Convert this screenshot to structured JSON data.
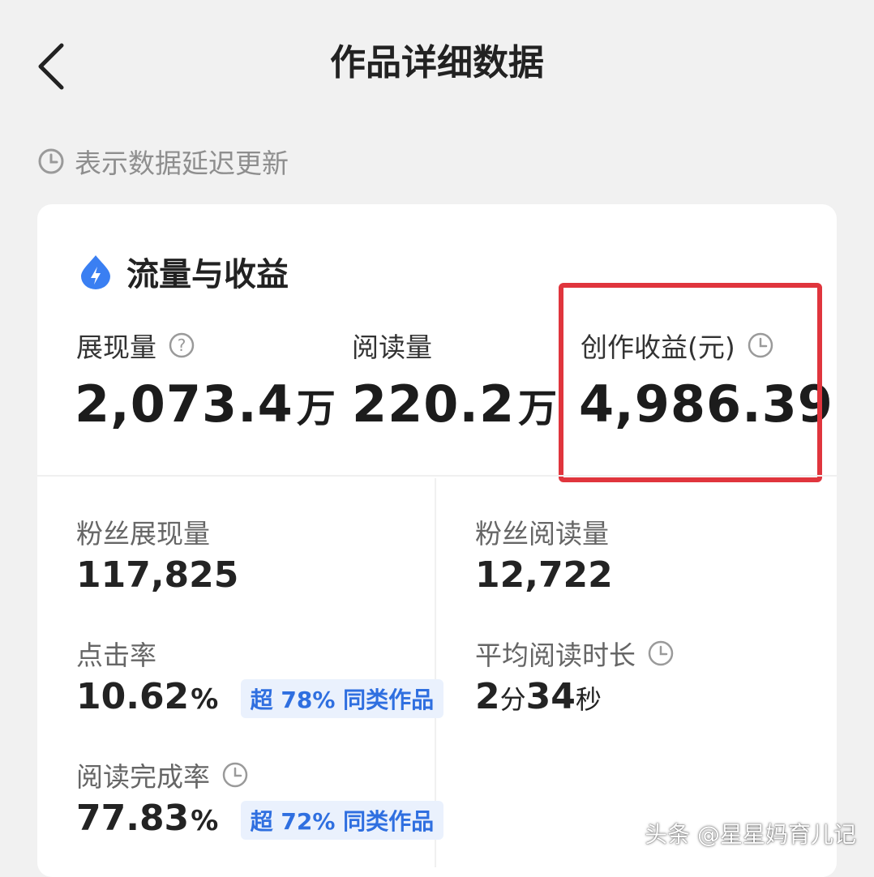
{
  "header": {
    "title": "作品详细数据"
  },
  "notice": {
    "text": "表示数据延迟更新"
  },
  "section": {
    "title": "流量与收益"
  },
  "metrics": {
    "impressions": {
      "label": "展现量",
      "value": "2,073.4",
      "unit": "万"
    },
    "reads": {
      "label": "阅读量",
      "value": "220.2",
      "unit": "万"
    },
    "earnings": {
      "label": "创作收益(元)",
      "value": "4,986.39"
    }
  },
  "details": {
    "fan_impressions": {
      "label": "粉丝展现量",
      "value": "117,825"
    },
    "fan_reads": {
      "label": "粉丝阅读量",
      "value": "12,722"
    },
    "ctr": {
      "label": "点击率",
      "value": "10.62",
      "pct": "%",
      "badge_pre": "超",
      "badge_num": "78%",
      "badge_post": "同类作品"
    },
    "avg_read_time": {
      "label": "平均阅读时长",
      "min": "2",
      "min_unit": "分",
      "sec": "34",
      "sec_unit": "秒"
    },
    "completion": {
      "label": "阅读完成率",
      "value": "77.83",
      "pct": "%",
      "badge_pre": "超",
      "badge_num": "72%",
      "badge_post": "同类作品"
    }
  },
  "watermark": {
    "text": "头条 @星星妈育儿记"
  },
  "colors": {
    "accent_blue": "#2f6fe0",
    "highlight_red": "#e0353d",
    "card_bg": "#ffffff",
    "page_bg": "#f1f1f1"
  },
  "icons": [
    "back-arrow-icon",
    "clock-icon",
    "lightning-icon",
    "help-icon"
  ]
}
